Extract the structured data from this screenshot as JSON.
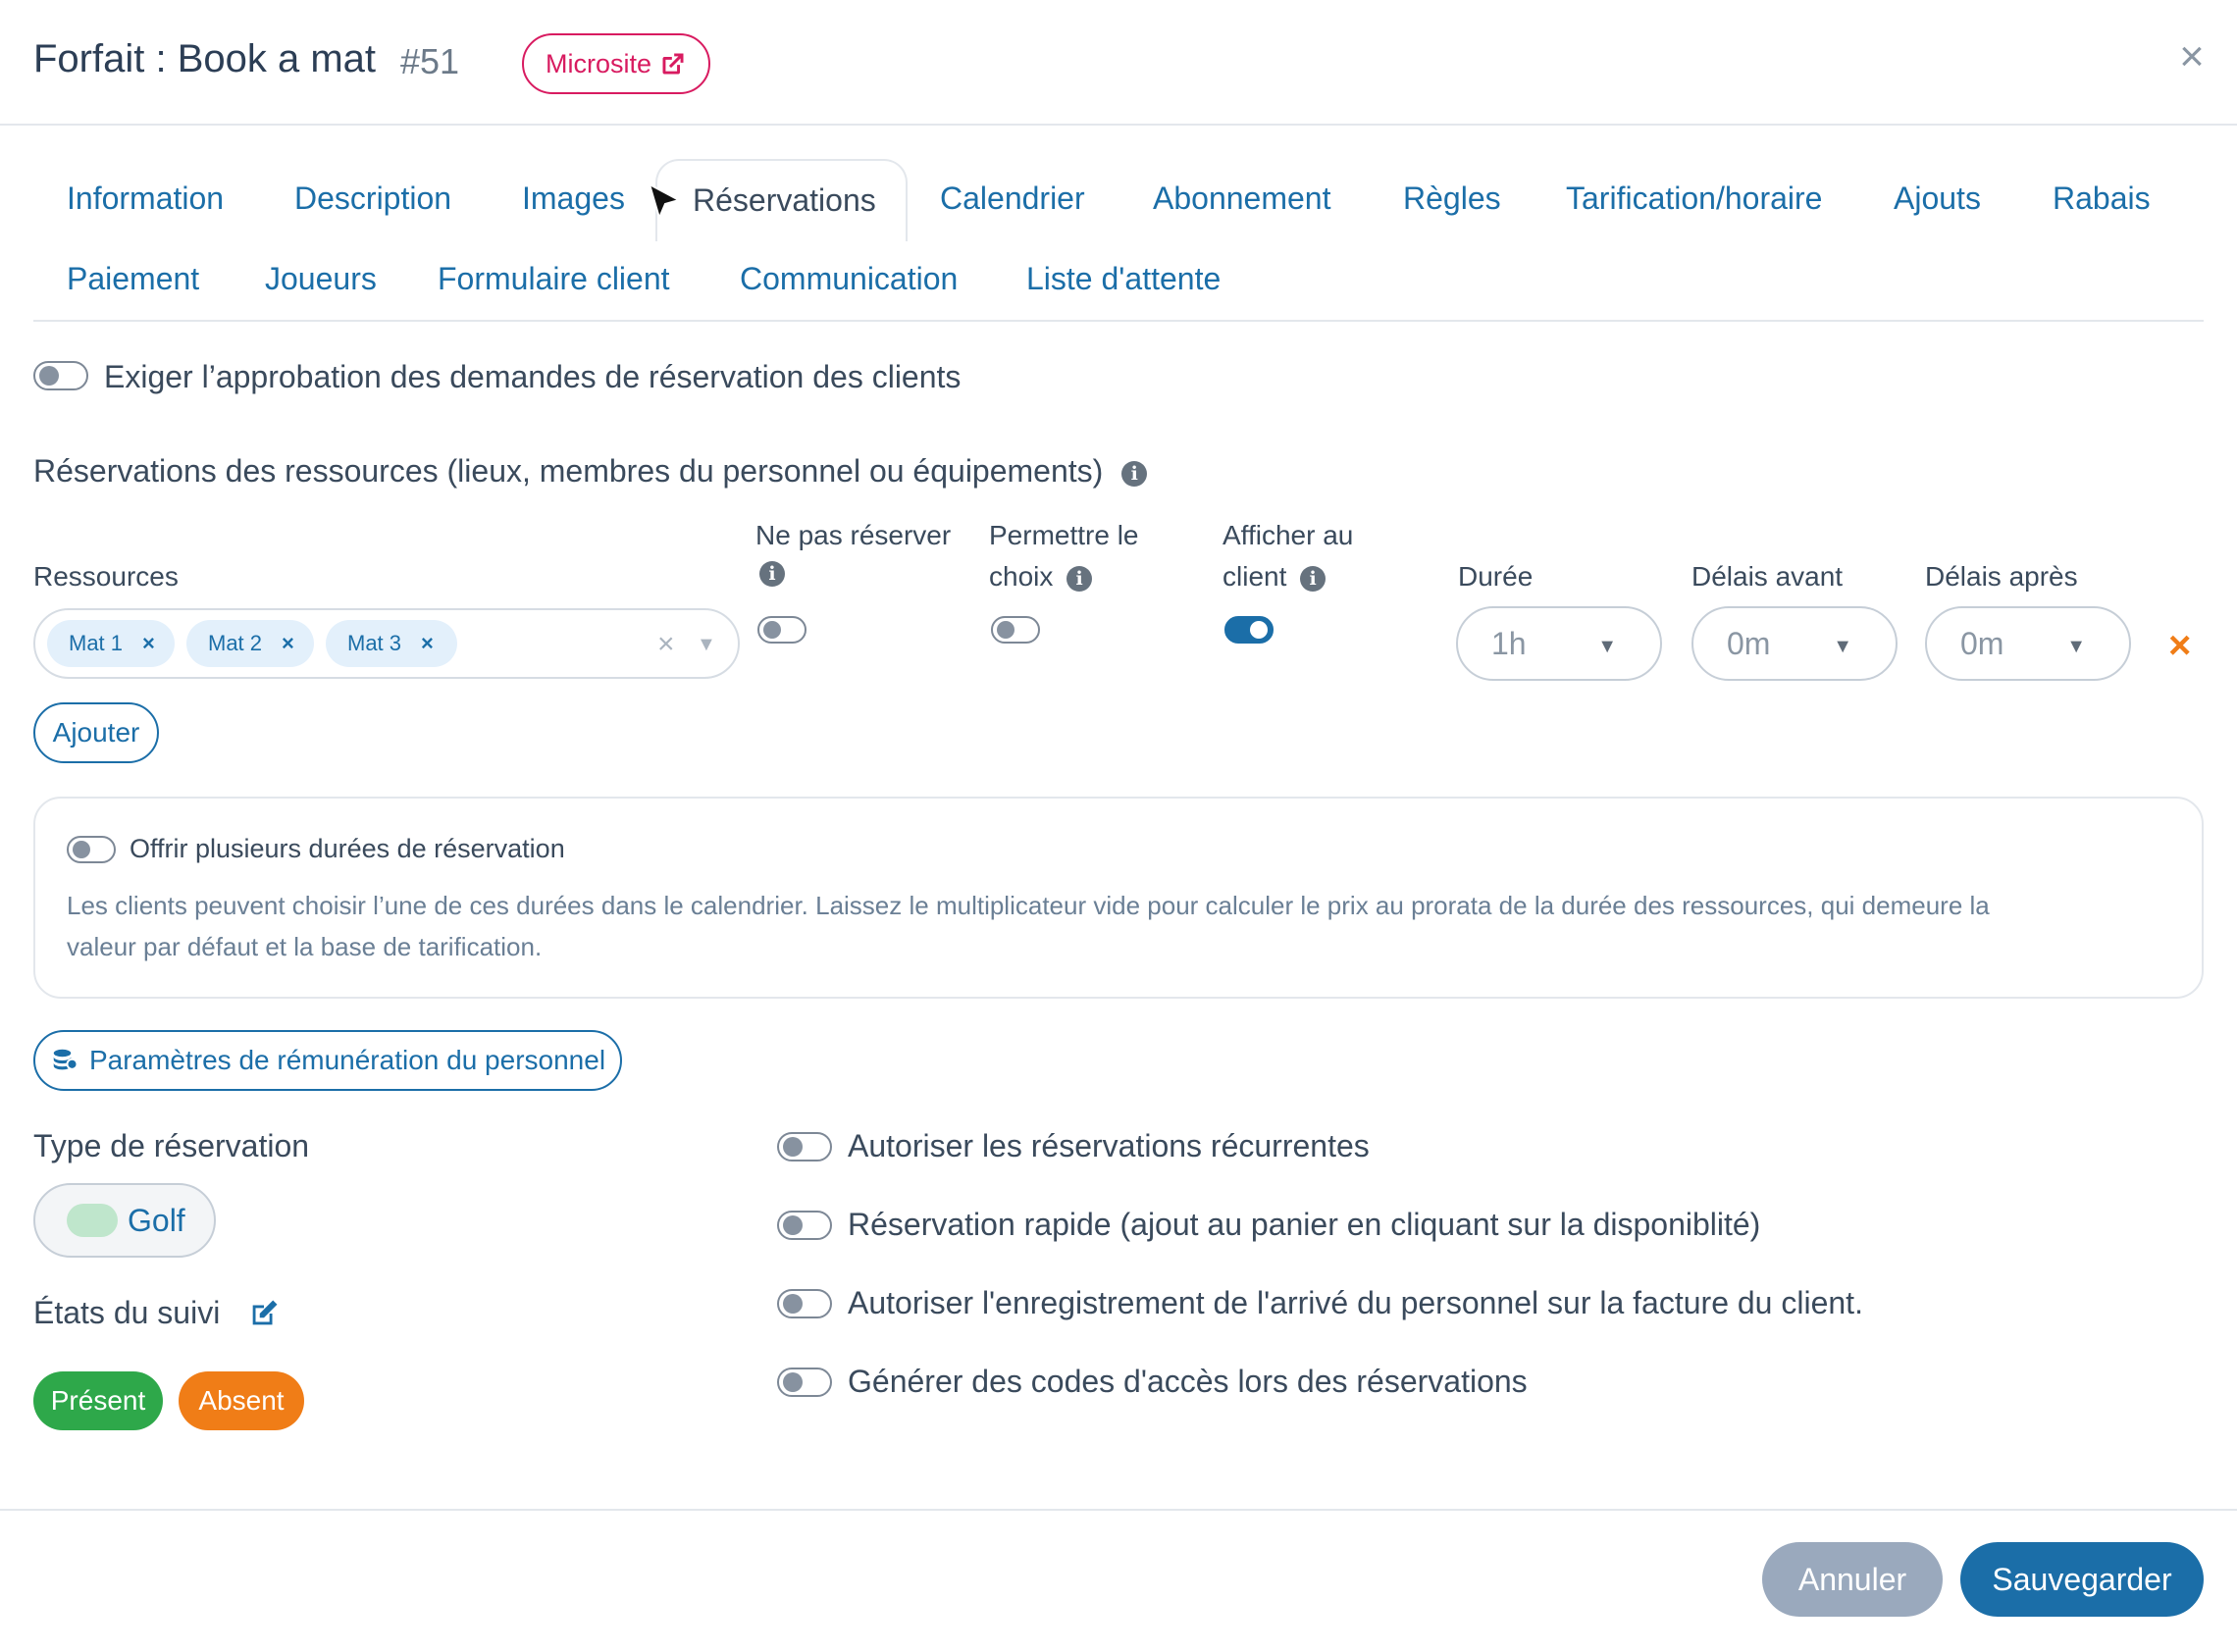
{
  "header": {
    "title": "Forfait : Book a mat",
    "number": "#51",
    "microsite_label": "Microsite",
    "close_symbol": "×"
  },
  "tabs": [
    {
      "label": "Information"
    },
    {
      "label": "Description"
    },
    {
      "label": "Images"
    },
    {
      "label": "Réservations",
      "active": true
    },
    {
      "label": "Calendrier"
    },
    {
      "label": "Abonnement"
    },
    {
      "label": "Règles"
    },
    {
      "label": "Tarification/horaire"
    },
    {
      "label": "Ajouts"
    },
    {
      "label": "Rabais"
    },
    {
      "label": "Paiement"
    },
    {
      "label": "Joueurs"
    },
    {
      "label": "Formulaire client"
    },
    {
      "label": "Communication"
    },
    {
      "label": "Liste d'attente"
    }
  ],
  "approval": {
    "label": "Exiger l’approbation des demandes de réservation des clients",
    "enabled": false
  },
  "resources": {
    "section_title": "Réservations des ressources (lieux, membres du personnel ou équipements)",
    "col_resources": "Ressources",
    "col_no_book": "Ne pas réserver",
    "col_allow_choice_1": "Permettre le",
    "col_allow_choice_2": "choix",
    "col_show_client_1": "Afficher au",
    "col_show_client_2": "client",
    "col_duration": "Durée",
    "col_delay_before": "Délais avant",
    "col_delay_after": "Délais après",
    "chips": [
      "Mat 1",
      "Mat 2",
      "Mat 3"
    ],
    "chip_remove": "×",
    "no_book": false,
    "allow_choice": false,
    "show_client": true,
    "duration": "1h",
    "delay_before": "0m",
    "delay_after": "0m",
    "remove_row": "×",
    "add_label": "Ajouter"
  },
  "multi_duration": {
    "label": "Offrir plusieurs durées de réservation",
    "enabled": false,
    "help_line1": "Les clients peuvent choisir l’une de ces durées dans le calendrier. Laissez le multiplicateur vide pour calculer le prix au prorata de la durée des ressources, qui demeure la",
    "help_line2": "valeur par défaut et la base de tarification."
  },
  "staff_pay_label": "Paramètres de rémunération du personnel",
  "booking_type": {
    "label": "Type de réservation",
    "value": "Golf",
    "color": "#bfe6cc"
  },
  "tracking": {
    "label": "États du suivi",
    "states": [
      {
        "label": "Présent",
        "color": "#2ea84a"
      },
      {
        "label": "Absent",
        "color": "#f07d17"
      }
    ]
  },
  "options": [
    {
      "label": "Autoriser les réservations récurrentes",
      "enabled": false
    },
    {
      "label": "Réservation rapide (ajout au panier en cliquant sur la disponiblité)",
      "enabled": false
    },
    {
      "label": "Autoriser l'enregistrement de l'arrivé du personnel sur la facture du client.",
      "enabled": false
    },
    {
      "label": "Générer des codes d'accès lors des réservations",
      "enabled": false
    }
  ],
  "footer": {
    "cancel_label": "Annuler",
    "save_label": "Sauvegarder"
  },
  "colors": {
    "accent": "#1b6ea8",
    "microsite": "#d81b60",
    "remove": "#f07d17"
  }
}
